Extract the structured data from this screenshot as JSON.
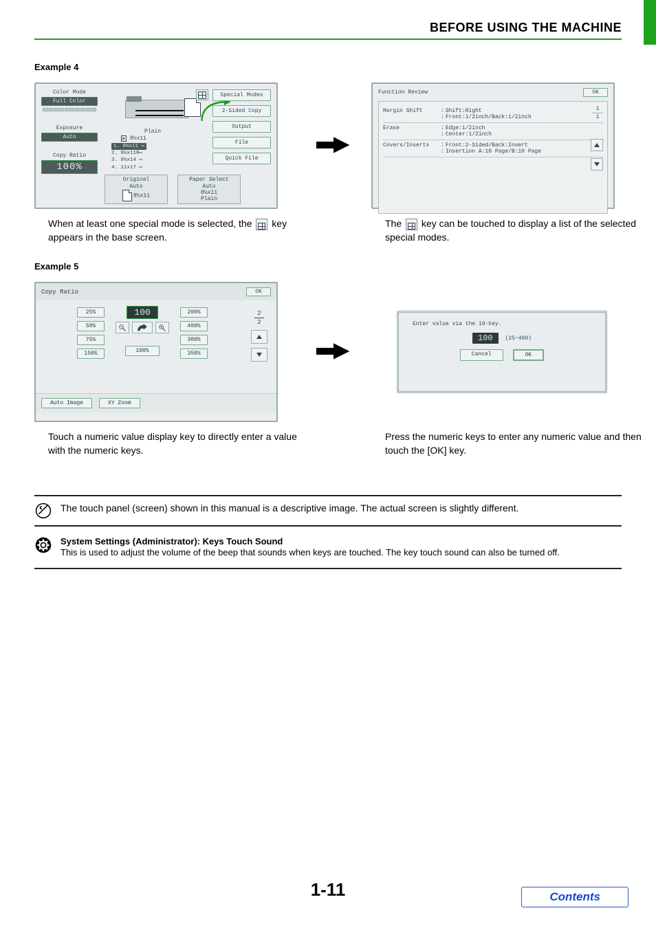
{
  "header": {
    "title": "BEFORE USING THE MACHINE"
  },
  "example4": {
    "heading": "Example 4",
    "panel1": {
      "color_mode_label": "Color Mode",
      "color_mode_value": "Full Color",
      "exposure_label": "Exposure",
      "exposure_value": "Auto",
      "copy_ratio_label": "Copy Ratio",
      "copy_ratio_value": "100%",
      "plain": "Plain",
      "plain_size": "8½x11",
      "trays": {
        "1": "8½x11",
        "2": "8½x11R",
        "3": "8½x14",
        "4": "11x17"
      },
      "special_modes": "Special Modes",
      "two_sided": "2-Sided Copy",
      "output": "Output",
      "file": "File",
      "quick_file": "Quick File",
      "original_hd": "Original",
      "original_v": "Auto",
      "original_size": "8½x11",
      "paper_hd": "Paper Select",
      "paper_v1": "Auto",
      "paper_v2": "8½x11",
      "paper_v3": "Plain"
    },
    "caption1_a": "When at least one special mode is selected, the ",
    "caption1_b": " key appears in the base screen.",
    "panel2": {
      "title": "Function Review",
      "ok": "OK",
      "rows": [
        {
          "label": "Margin Shift",
          "l1": "Shift:Right",
          "l2": "Front:1/2inch/Back:1/2inch"
        },
        {
          "label": "Erase",
          "l1": "Edge:1/2inch",
          "l2": "Center:1/2inch"
        },
        {
          "label": "Covers/Inserts",
          "l1": "Front:2-Sided/Back:Insert",
          "l2": "Insertion A:10 Page/B:10 Page"
        }
      ],
      "counter_top": "1",
      "counter_bot": "1"
    },
    "caption2_a": "The ",
    "caption2_b": " key can be touched to display a list of the selected special modes."
  },
  "example5": {
    "heading": "Example 5",
    "panel3": {
      "title": "Copy Ratio",
      "ok": "OK",
      "left": [
        "25%",
        "50%",
        "75%",
        "150%"
      ],
      "right": [
        "200%",
        "400%",
        "300%",
        "350%"
      ],
      "value": "100",
      "hundred": "100%",
      "frac_top": "2",
      "frac_bot": "2",
      "auto_image": "Auto Image",
      "xy_zoom": "XY Zoom"
    },
    "caption3": "Touch a numeric value display key to directly enter a value with the numeric keys.",
    "panel4": {
      "msg": "Enter value via the 10-key.",
      "value": "100",
      "range": "(25~400)",
      "cancel": "Cancel",
      "ok": "OK"
    },
    "caption4": "Press the numeric keys to enter any numeric value and then touch the [OK] key."
  },
  "note1": "The touch panel (screen) shown in this manual is a descriptive image. The actual screen is slightly different.",
  "sys": {
    "title": "System Settings (Administrator): Keys Touch Sound",
    "body": "This is used to adjust the volume of the beep that sounds when keys are touched. The key touch sound can also be turned off."
  },
  "page_number": "1-11",
  "contents_label": "Contents"
}
